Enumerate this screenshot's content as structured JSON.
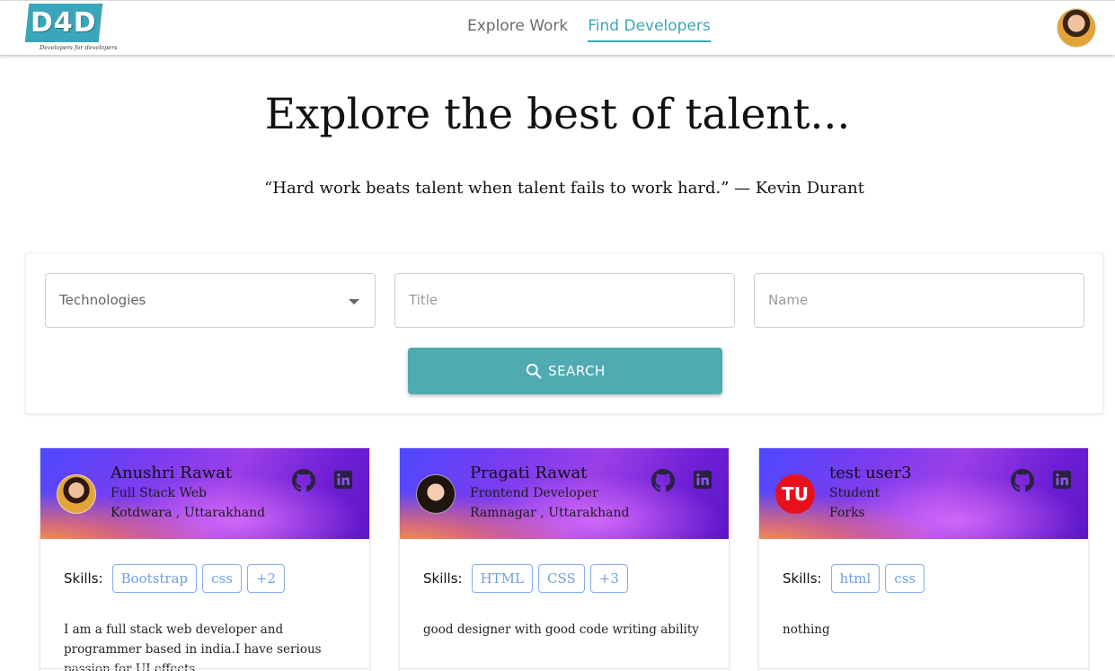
{
  "brand": {
    "logo_text": "D4D",
    "tagline": "Developers for developers",
    "accent_color": "#3aa6b9"
  },
  "nav": {
    "links": [
      {
        "label": "Explore Work",
        "active": false
      },
      {
        "label": "Find Developers",
        "active": true
      }
    ],
    "user_avatar_icon": "user-avatar"
  },
  "hero": {
    "title": "Explore the best of talent...",
    "quote": "“Hard work beats talent when talent fails to work hard.” — Kevin Durant"
  },
  "search": {
    "technologies_placeholder": "Technologies",
    "title_placeholder": "Title",
    "name_placeholder": "Name",
    "button_label": "SEARCH",
    "button_color": "#4fabb1"
  },
  "cards": [
    {
      "name": "Anushri Rawat",
      "title": "Full Stack Web",
      "location": "Kotdwara , Uttarakhand",
      "skills_label": "Skills:",
      "skills": [
        "Bootstrap",
        "css",
        "+2"
      ],
      "description": "I am a full stack web developer and programmer based in india.I have serious passion for UI effects,"
    },
    {
      "name": "Pragati Rawat",
      "title": "Frontend Developer",
      "location": "Ramnagar , Uttarakhand",
      "skills_label": "Skills:",
      "skills": [
        "HTML",
        "CSS",
        "+3"
      ],
      "description": "good designer with good code writing ability"
    },
    {
      "name": "test user3",
      "initials": "TU",
      "title": "Student",
      "location": "Forks",
      "skills_label": "Skills:",
      "skills": [
        "html",
        "css"
      ],
      "description": "nothing"
    }
  ]
}
